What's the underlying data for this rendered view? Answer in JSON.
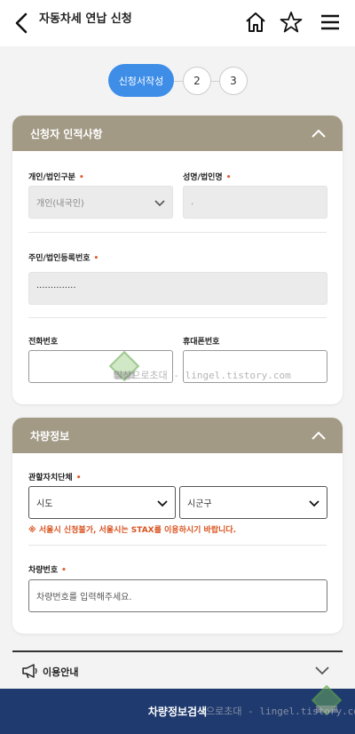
{
  "header": {
    "title": "자동차세 연납 신청",
    "icons": [
      "back-icon",
      "home-icon",
      "star-icon",
      "menu-icon"
    ]
  },
  "stepper": {
    "steps": [
      "신청서작성",
      "2",
      "3"
    ],
    "active_color": "#3e8ee8"
  },
  "applicant_section": {
    "title": "신청자 인적사항",
    "type_label": "개인/법인구분",
    "type_value": "개인(내국인)",
    "name_label": "성명/법인명",
    "name_value": ".",
    "regno_label": "주민/법인등록번호",
    "regno_value": "··············",
    "phone_label": "전화번호",
    "phone_value": "",
    "mobile_label": "휴대폰번호",
    "mobile_value": ""
  },
  "vehicle_section": {
    "title": "차량정보",
    "region_label": "관할자치단체",
    "sido_value": "시도",
    "sigungu_value": "시군구",
    "notice": "※ 서울시 신청불가, 서울시는 STAX를 이용하시기 바랍니다.",
    "plate_label": "차량번호",
    "plate_placeholder": "차량번호를 입력해주세요."
  },
  "guide": {
    "label": "이용안내"
  },
  "bottom_button": {
    "label": "차량정보검색"
  },
  "watermark": {
    "center": "일상으로초대 - lingel.tistory.com",
    "bottom": "으로초대 - lingel.tistory.com"
  },
  "colors": {
    "section_header": "#a39a86",
    "primary_button": "#1f3a6e",
    "required": "#e05a2a"
  }
}
